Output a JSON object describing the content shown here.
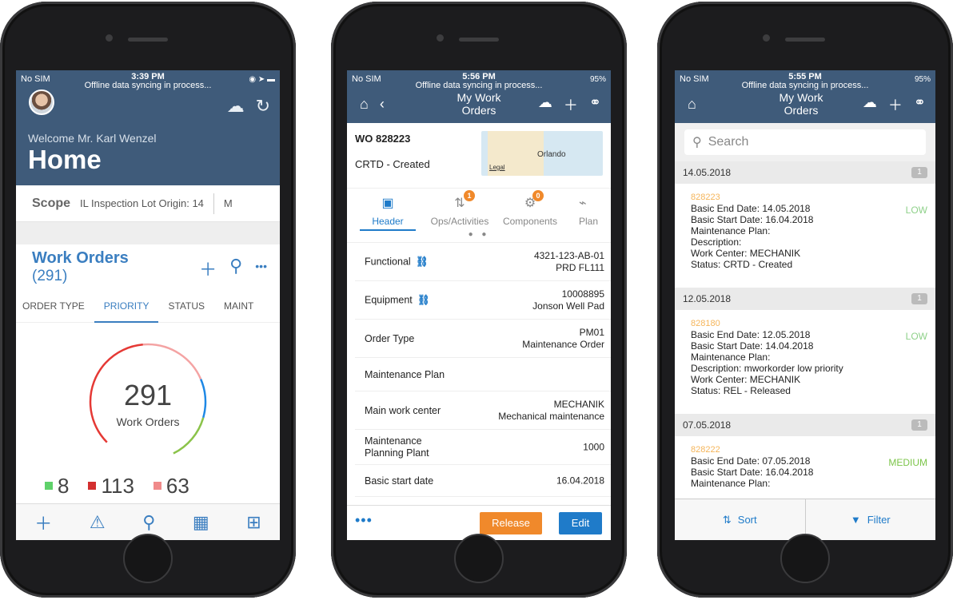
{
  "colors": {
    "header": "#3f5b7a",
    "accent": "#1f7bc9",
    "release": "#f0892b",
    "low": "#8fd18a",
    "medium": "#7cc54a",
    "orderid": "#f5b55a"
  },
  "phone1": {
    "status": {
      "carrier": "No SIM",
      "time": "3:39 PM",
      "sync": "Offline data syncing in process..."
    },
    "welcome": "Welcome Mr. Karl Wenzel",
    "title": "Home",
    "scope": {
      "label": "Scope",
      "value": "IL Inspection Lot Origin: 14",
      "next": "M"
    },
    "work_orders": {
      "title": "Work Orders",
      "count": "(291)"
    },
    "tabs": [
      "ORDER TYPE",
      "PRIORITY",
      "STATUS",
      "MAINT"
    ],
    "donut": {
      "value": "291",
      "label": "Work Orders"
    },
    "counts": [
      {
        "value": "8",
        "color": "#5fd16a"
      },
      {
        "value": "113",
        "color": "#d32f2f"
      },
      {
        "value": "63",
        "color": "#f08a8a"
      }
    ],
    "bottom_icons": [
      "plus-icon",
      "warning-icon",
      "search-icon",
      "map-icon",
      "grid-icon"
    ]
  },
  "phone2": {
    "status": {
      "carrier": "No SIM",
      "time": "5:56 PM",
      "sync": "Offline data syncing in process...",
      "battery": "95%"
    },
    "nav_title": "My Work Orders",
    "wo_id": "WO 828223",
    "wo_status": "CRTD - Created",
    "map_label": "Orlando",
    "map_legal": "Legal",
    "tabs": [
      {
        "label": "Header",
        "badge": ""
      },
      {
        "label": "Ops/Activities",
        "badge": "1"
      },
      {
        "label": "Components",
        "badge": "0"
      },
      {
        "label": "Plan",
        "badge": ""
      }
    ],
    "fields": [
      {
        "key": "Functional",
        "v1": "4321-123-AB-01",
        "v2": "PRD FL111"
      },
      {
        "key": "Equipment",
        "v1": "10008895",
        "v2": "Jonson Well Pad"
      },
      {
        "key": "Order Type",
        "v1": "PM01",
        "v2": "Maintenance Order"
      },
      {
        "key": "Maintenance Plan",
        "v1": "",
        "v2": ""
      },
      {
        "key": "Main work center",
        "v1": "MECHANIK",
        "v2": "Mechanical maintenance"
      },
      {
        "key": "Maintenance Planning Plant",
        "v1": "1000",
        "v2": ""
      },
      {
        "key": "Basic start date",
        "v1": "16.04.2018",
        "v2": ""
      }
    ],
    "more": "•••",
    "release": "Release",
    "edit": "Edit"
  },
  "phone3": {
    "status": {
      "carrier": "No SIM",
      "time": "5:55 PM",
      "sync": "Offline data syncing in process...",
      "battery": "95%"
    },
    "nav_title": "My Work Orders",
    "search_placeholder": "Search",
    "groups": [
      {
        "date": "14.05.2018",
        "count": "1",
        "id": "828223",
        "priority": "LOW",
        "lines": [
          "Basic End Date: 14.05.2018",
          "Basic Start Date: 16.04.2018",
          "Maintenance Plan:",
          "Description:",
          "Work Center: MECHANIK",
          "Status: CRTD - Created"
        ]
      },
      {
        "date": "12.05.2018",
        "count": "1",
        "id": "828180",
        "priority": "LOW",
        "lines": [
          "Basic End Date: 12.05.2018",
          "Basic Start Date: 14.04.2018",
          "Maintenance Plan:",
          "Description: mworkorder low priority",
          "Work Center: MECHANIK",
          "Status: REL - Released"
        ]
      },
      {
        "date": "07.05.2018",
        "count": "1",
        "id": "828222",
        "priority": "MEDIUM",
        "lines": [
          "Basic End Date: 07.05.2018",
          "Basic Start Date: 16.04.2018",
          "Maintenance Plan:"
        ]
      }
    ],
    "sort": "Sort",
    "filter": "Filter"
  }
}
